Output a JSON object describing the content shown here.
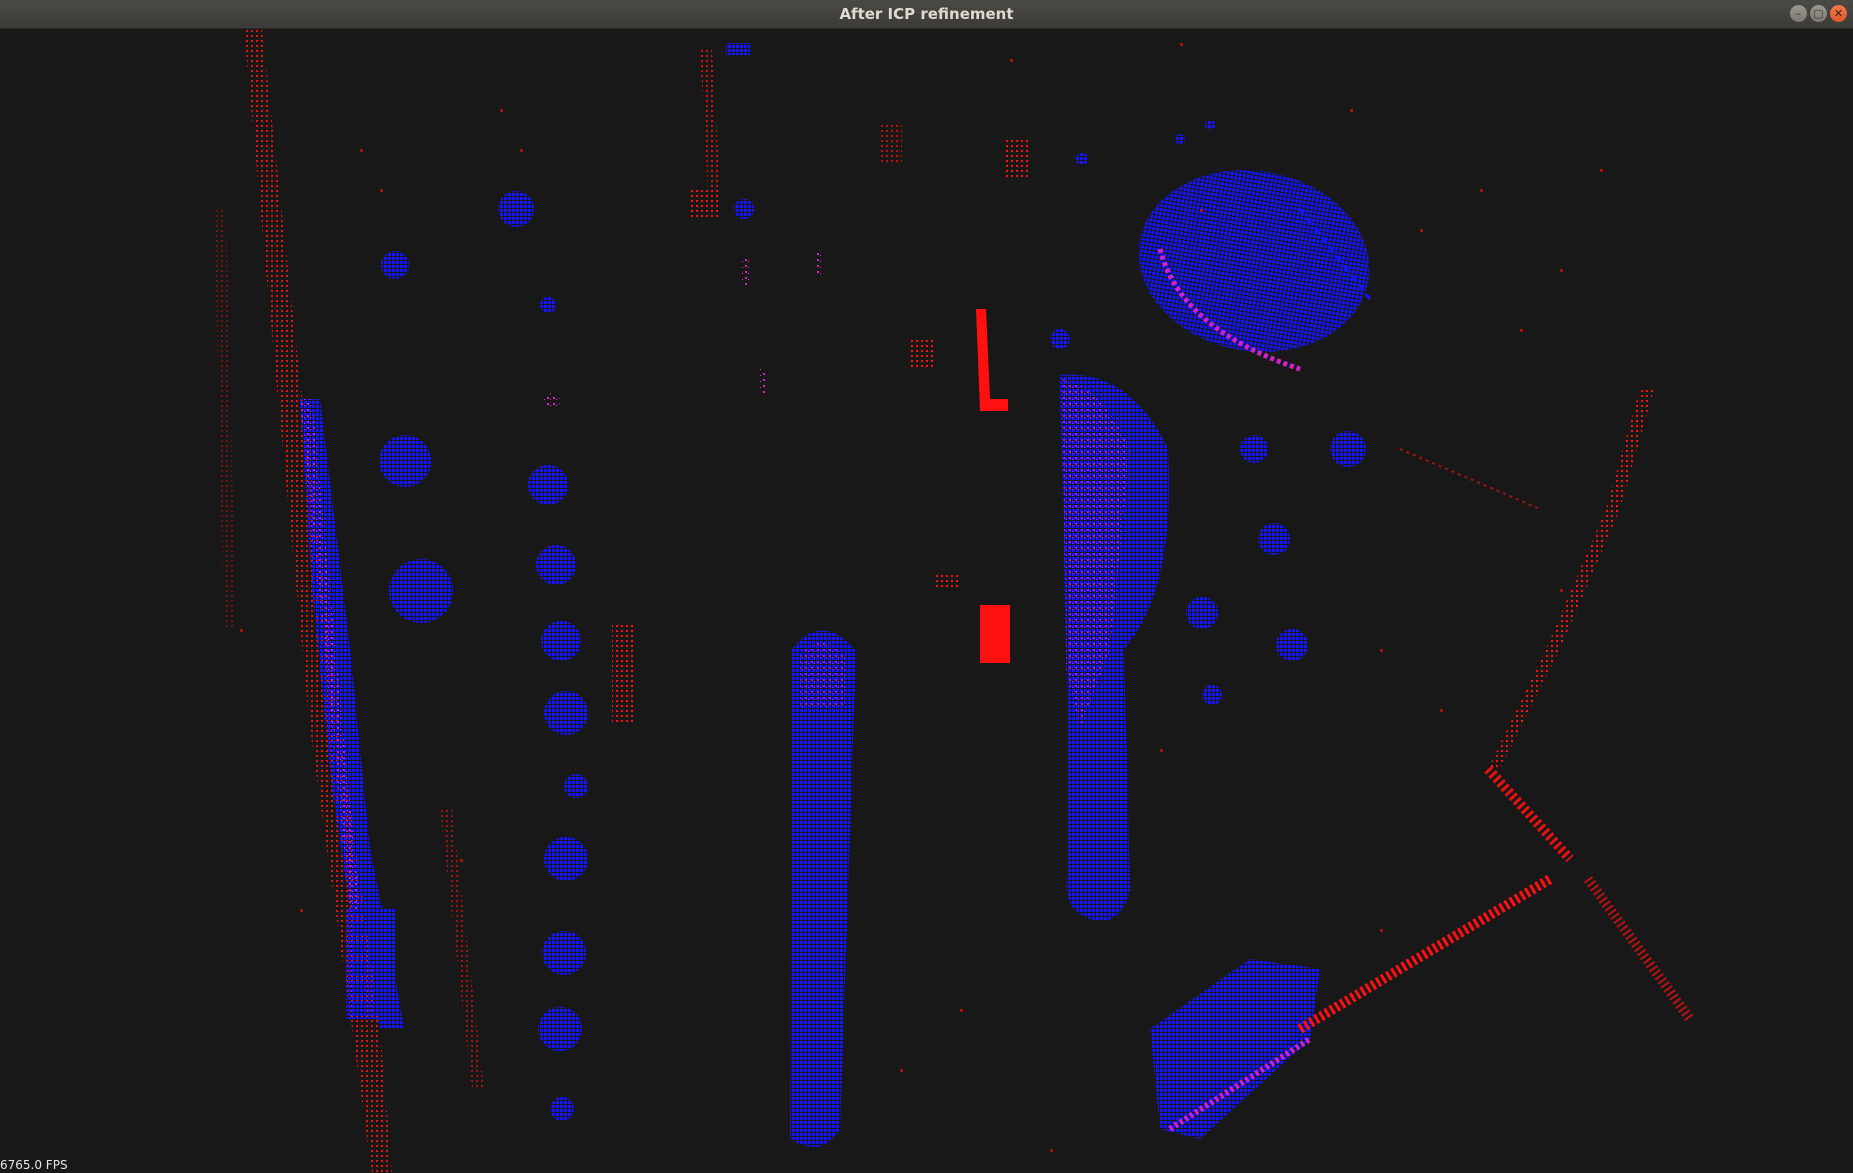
{
  "window": {
    "title": "After ICP refinement",
    "controls": {
      "minimize": "–",
      "maximize": "▢",
      "close": "✕"
    }
  },
  "viewport": {
    "fps_label": "6765.0 FPS",
    "colors": {
      "background": "#181818",
      "source_cloud": "#ff1010",
      "target_cloud": "#1010ff",
      "overlap": "#c818c8"
    }
  }
}
